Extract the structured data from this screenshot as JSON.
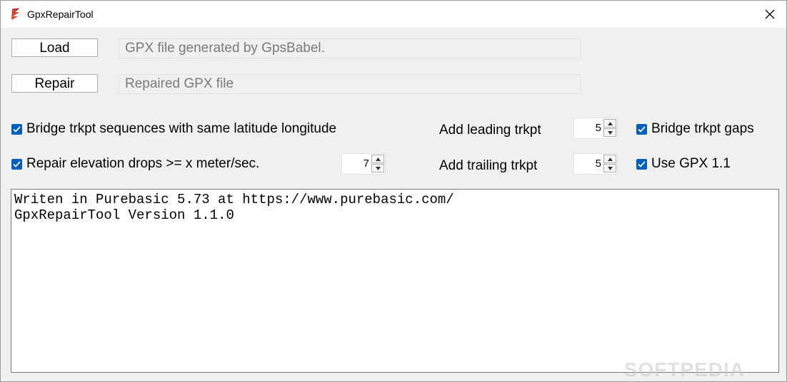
{
  "window": {
    "title": "GpxRepairTool"
  },
  "load": {
    "button_label": "Load",
    "field_value": "GPX file generated by GpsBabel."
  },
  "repair": {
    "button_label": "Repair",
    "field_value": "Repaired GPX file"
  },
  "options": {
    "bridge_same_latlon": {
      "label": "Bridge trkpt sequences with same latitude longitude",
      "checked": true
    },
    "repair_elevation": {
      "label": "Repair elevation drops >= x meter/sec.",
      "checked": true,
      "value": "7"
    },
    "add_leading": {
      "label": "Add leading trkpt",
      "value": "5"
    },
    "add_trailing": {
      "label": "Add trailing trkpt",
      "value": "5"
    },
    "bridge_gaps": {
      "label": "Bridge trkpt gaps",
      "checked": true
    },
    "use_gpx11": {
      "label": "Use GPX 1.1",
      "checked": true
    }
  },
  "log": {
    "line1": "Writen in Purebasic 5.73 at https://www.purebasic.com/",
    "line2": "GpxRepairTool Version 1.1.0"
  },
  "watermark": "SOFTPEDIA",
  "colors": {
    "checkbox": "#005fb8",
    "background": "#f0f0f0"
  }
}
